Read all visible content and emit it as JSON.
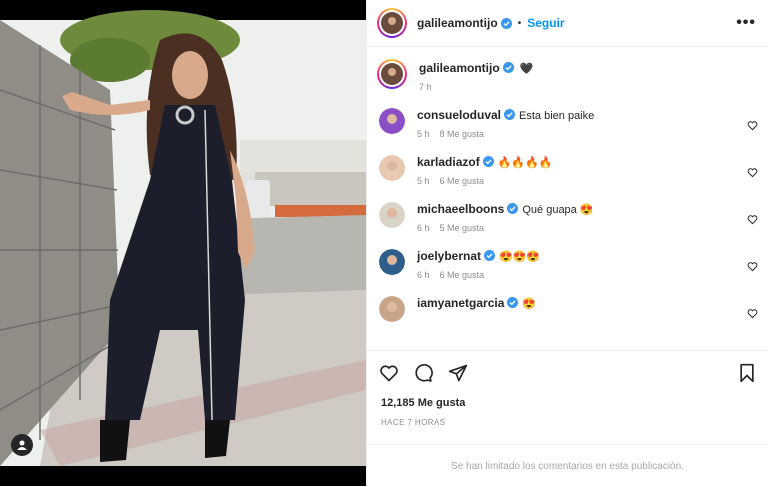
{
  "post": {
    "author": "galileamontijo",
    "follow_label": "Seguir",
    "separator": "•",
    "more_label": "•••",
    "caption_emoji": "🖤",
    "caption_time": "7 h"
  },
  "comments": [
    {
      "user": "consueloduval",
      "text": "Esta bien paike",
      "time": "5 h",
      "likes": "8 Me gusta",
      "avatar_color": "#8a4fc7"
    },
    {
      "user": "karladiazof",
      "text": "🔥🔥🔥🔥",
      "time": "5 h",
      "likes": "6 Me gusta",
      "avatar_color": "#e8c8b0"
    },
    {
      "user": "michaeelboons",
      "text": "Qué guapa 😍",
      "time": "6 h",
      "likes": "5 Me gusta",
      "avatar_color": "#d9d4c6"
    },
    {
      "user": "joelybernat",
      "text": "😍😍😍",
      "time": "6 h",
      "likes": "6 Me gusta",
      "avatar_color": "#2e5f8a"
    },
    {
      "user": "iamyanetgarcia",
      "text": "😍",
      "time": "",
      "likes": "",
      "avatar_color": "#c8a488"
    }
  ],
  "stats": {
    "likes": "12,185 Me gusta",
    "time_ago": "HACE 7 HORAS"
  },
  "footer": {
    "limited_text": "Se han limitado los comentarios en esta publicación."
  },
  "colors": {
    "accent": "#0095f6",
    "verified": "#3897f0",
    "muted": "#8e8e8e"
  }
}
